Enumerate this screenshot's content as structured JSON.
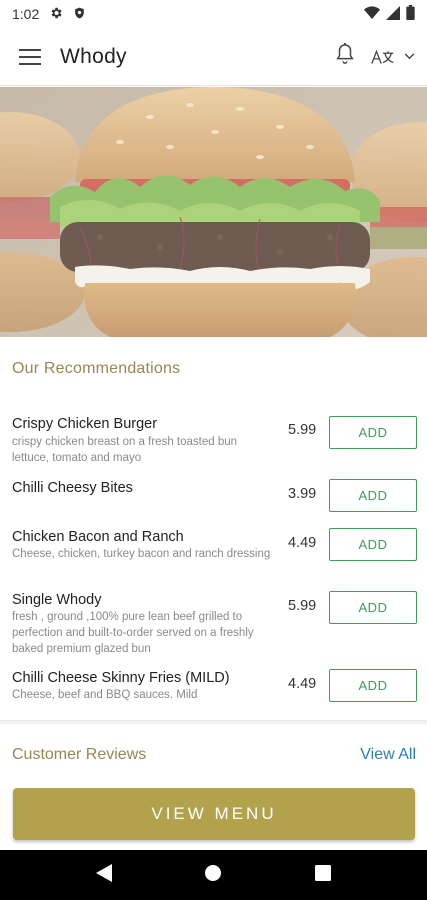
{
  "status_bar": {
    "time": "1:02"
  },
  "app_bar": {
    "title": "Whody"
  },
  "recommendations": {
    "title": "Our Recommendations",
    "add_label": "ADD",
    "items": [
      {
        "name": "Crispy Chicken Burger",
        "desc": "crispy chicken breast on a fresh toasted bun lettuce, tomato and mayo",
        "price": "5.99"
      },
      {
        "name": "Chilli Cheesy Bites",
        "desc": "",
        "price": "3.99"
      },
      {
        "name": "Chicken Bacon and Ranch",
        "desc": "Cheese, chicken, turkey bacon and ranch dressing",
        "price": "4.49"
      },
      {
        "name": "Single Whody",
        "desc": "fresh , ground ,100% pure lean beef grilled to perfection and built-to-order served on a freshly baked premium glazed bun",
        "price": "5.99"
      },
      {
        "name": "Chilli Cheese Skinny Fries (MILD)",
        "desc": "Cheese, beef and BBQ sauces. Mild",
        "price": "4.49"
      }
    ]
  },
  "reviews": {
    "title": "Customer Reviews",
    "view_all": "View All"
  },
  "view_menu": {
    "label": "VIEW MENU"
  },
  "colors": {
    "accent_gold": "#b3a24c",
    "section_title": "#9b8652",
    "add_green": "#3aa05a",
    "link_blue": "#2a7fb8"
  }
}
